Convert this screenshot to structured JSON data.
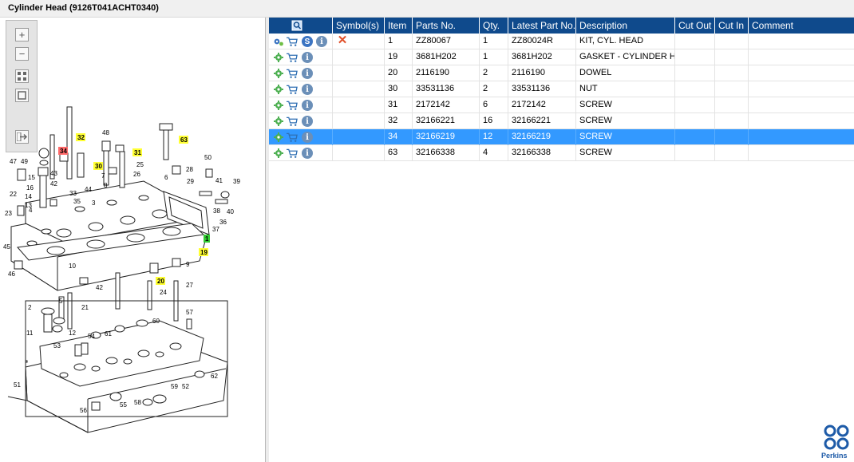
{
  "window": {
    "title": "Cylinder Head (9126T041ACHT0340)"
  },
  "zoom_toolbar": {
    "zoom_in": "+",
    "zoom_out": "−",
    "fit_all": "",
    "actual_size": "",
    "export": ""
  },
  "diagram": {
    "callouts": [
      "34",
      "32",
      "31",
      "30",
      "63",
      "19",
      "20",
      "1"
    ],
    "labels": [
      "48",
      "49",
      "47",
      "15",
      "16",
      "14",
      "13",
      "22",
      "23",
      "4",
      "43",
      "42",
      "33",
      "44",
      "35",
      "3",
      "7",
      "8",
      "6",
      "26",
      "25",
      "28",
      "29",
      "50",
      "41",
      "39",
      "40",
      "38",
      "36",
      "37",
      "45",
      "46",
      "9",
      "27",
      "24",
      "2",
      "11",
      "10",
      "12",
      "21",
      "5",
      "52",
      "53",
      "54",
      "55",
      "56",
      "57",
      "58",
      "59",
      "60",
      "61",
      "62",
      "51"
    ]
  },
  "grid": {
    "columns": [
      "",
      "Symbol(s)",
      "Item",
      "Parts No.",
      "Qty.",
      "Latest Part No.",
      "Description",
      "Cut Out",
      "Cut In",
      "Comment"
    ],
    "rows": [
      {
        "item": "1",
        "parts_no": "ZZ80067",
        "qty": "1",
        "latest": "ZZ80024R",
        "description": "KIT, CYL. HEAD",
        "cut_out": "",
        "cut_in": "",
        "comment": "",
        "has_service": true,
        "has_symbol": true
      },
      {
        "item": "19",
        "parts_no": "3681H202",
        "qty": "1",
        "latest": "3681H202",
        "description": "GASKET - CYLINDER HEAD",
        "cut_out": "",
        "cut_in": "",
        "comment": "",
        "has_service": false,
        "has_symbol": false
      },
      {
        "item": "20",
        "parts_no": "2116190",
        "qty": "2",
        "latest": "2116190",
        "description": "DOWEL",
        "cut_out": "",
        "cut_in": "",
        "comment": "",
        "has_service": false,
        "has_symbol": false
      },
      {
        "item": "30",
        "parts_no": "33531136",
        "qty": "2",
        "latest": "33531136",
        "description": "NUT",
        "cut_out": "",
        "cut_in": "",
        "comment": "",
        "has_service": false,
        "has_symbol": false
      },
      {
        "item": "31",
        "parts_no": "2172142",
        "qty": "6",
        "latest": "2172142",
        "description": "SCREW",
        "cut_out": "",
        "cut_in": "",
        "comment": "",
        "has_service": false,
        "has_symbol": false
      },
      {
        "item": "32",
        "parts_no": "32166221",
        "qty": "16",
        "latest": "32166221",
        "description": "SCREW",
        "cut_out": "",
        "cut_in": "",
        "comment": "",
        "has_service": false,
        "has_symbol": false
      },
      {
        "item": "34",
        "parts_no": "32166219",
        "qty": "12",
        "latest": "32166219",
        "description": "SCREW",
        "cut_out": "",
        "cut_in": "",
        "comment": "",
        "has_service": false,
        "has_symbol": false
      },
      {
        "item": "63",
        "parts_no": "32166338",
        "qty": "4",
        "latest": "32166338",
        "description": "SCREW",
        "cut_out": "",
        "cut_in": "",
        "comment": "",
        "has_service": false,
        "has_symbol": false
      }
    ],
    "selected_row_index": 6
  },
  "brand": {
    "name": "Perkins"
  },
  "colors": {
    "header_bg": "#0f4a8c",
    "selection": "#3399ff",
    "callout_yellow": "#ffff33",
    "callout_red": "#ff6b6b",
    "callout_green": "#33cc33"
  }
}
